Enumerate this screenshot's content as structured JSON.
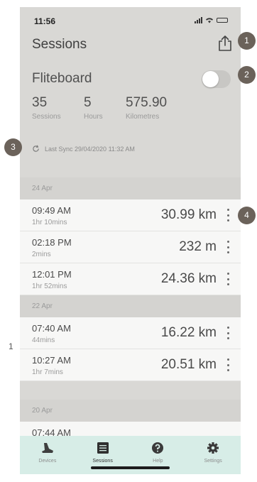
{
  "status_bar": {
    "time": "11:56"
  },
  "header": {
    "title": "Sessions",
    "share_icon": "share-icon"
  },
  "board": {
    "name": "Fliteboard",
    "toggle_on": false,
    "stats": [
      {
        "value": "35",
        "label": "Sessions"
      },
      {
        "value": "5",
        "label": "Hours"
      },
      {
        "value": "575.90",
        "label": "Kilometres"
      }
    ],
    "sync_text": "Last Sync 29/04/2020 11:32 AM"
  },
  "groups": [
    {
      "date": "24 Apr",
      "sessions": [
        {
          "time": "09:49 AM",
          "duration": "1hr 10mins",
          "distance": "30.99 km"
        },
        {
          "time": "02:18 PM",
          "duration": "2mins",
          "distance": "232 m"
        },
        {
          "time": "12:01 PM",
          "duration": "1hr 52mins",
          "distance": "24.36 km"
        }
      ]
    },
    {
      "date": "22 Apr",
      "sessions": [
        {
          "time": "07:40 AM",
          "duration": "44mins",
          "distance": "16.22 km"
        },
        {
          "time": "10:27 AM",
          "duration": "1hr 7mins",
          "distance": "20.51 km"
        }
      ]
    },
    {
      "date": "20 Apr",
      "sessions": [
        {
          "time": "07:44 AM",
          "duration": "",
          "distance": ""
        }
      ]
    }
  ],
  "tabs": [
    {
      "label": "Devices",
      "icon": "board-icon",
      "active": false
    },
    {
      "label": "Sessions",
      "icon": "list-icon",
      "active": true
    },
    {
      "label": "Help",
      "icon": "help-icon",
      "active": false
    },
    {
      "label": "Settings",
      "icon": "gear-icon",
      "active": false
    }
  ],
  "annotations": {
    "m1": "1",
    "m2": "2",
    "m3": "3",
    "m4": "4",
    "side": "1"
  },
  "colors": {
    "tab_bar": "#d7ede7",
    "background": "#d9d8d5",
    "marker": "#6b625a"
  }
}
